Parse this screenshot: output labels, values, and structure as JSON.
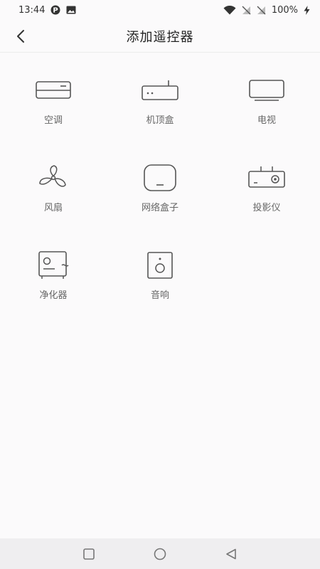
{
  "status_bar": {
    "time": "13:44",
    "battery": "100%",
    "icons": [
      "parking-app-icon",
      "gallery-icon",
      "wifi-icon",
      "no-sim-icon",
      "no-sim-icon",
      "charging-icon"
    ]
  },
  "header": {
    "title": "添加遥控器"
  },
  "devices": [
    {
      "label": "空调",
      "icon": "air-conditioner-icon"
    },
    {
      "label": "机顶盒",
      "icon": "set-top-box-icon"
    },
    {
      "label": "电视",
      "icon": "tv-icon"
    },
    {
      "label": "风扇",
      "icon": "fan-icon"
    },
    {
      "label": "网络盒子",
      "icon": "network-box-icon"
    },
    {
      "label": "投影仪",
      "icon": "projector-icon"
    },
    {
      "label": "净化器",
      "icon": "purifier-icon"
    },
    {
      "label": "音响",
      "icon": "speaker-icon"
    }
  ],
  "nav_bar": {
    "buttons": [
      "recents-icon",
      "home-icon",
      "back-triangle-icon"
    ]
  }
}
